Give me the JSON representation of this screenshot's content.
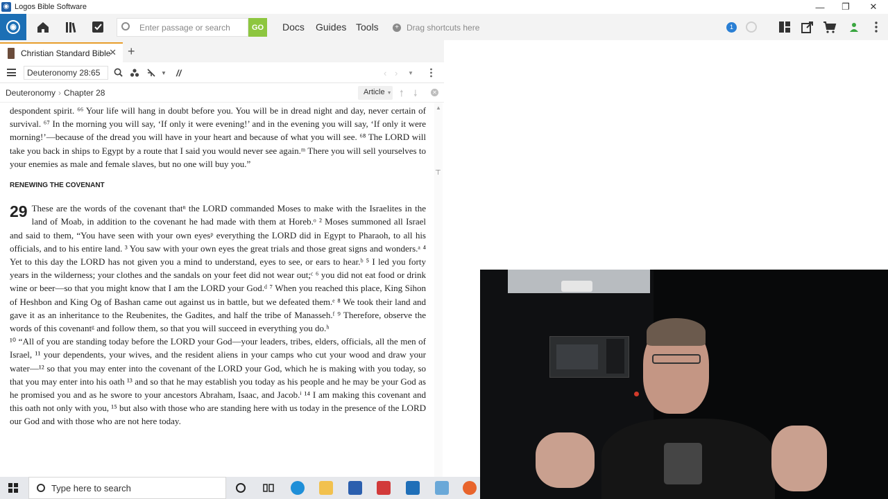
{
  "window": {
    "title": "Logos Bible Software",
    "minimize": "—",
    "restore": "❐",
    "close": "✕"
  },
  "toolbar": {
    "search_placeholder": "Enter passage or search",
    "go_label": "GO",
    "links": [
      "Docs",
      "Guides",
      "Tools"
    ],
    "shortcut_hint": "Drag shortcuts here",
    "notification_count": "1"
  },
  "tabs": [
    {
      "label": "Christian Standard Bible",
      "close": "✕"
    }
  ],
  "add_tab": "+",
  "panel": {
    "reference": "Deuteronomy 28:65",
    "parallel_icon": "//",
    "breadcrumb": [
      "Deuteronomy",
      "Chapter 28"
    ],
    "article_label": "Article"
  },
  "reader": {
    "p1": "despondent spirit. ⁶⁶ Your life will hang in doubt before you. You will be in dread night and day, never certain of survival. ⁶⁷ In the morning you will say, ‘If only it were evening!’ and in the evening you will say, ‘If only it were morning!’—because of the dread you will have in your heart and because of what you will see. ⁶⁸ The LORD will take you back in ships to Egypt by a route that I said you would never see again.ᵐ There you will sell yourselves to your enemies as male and female slaves, but no one will buy you.”",
    "heading": "RENEWING THE COVENANT",
    "chapter": "29",
    "p2": "These are the words of the covenant thatⁿ the LORD commanded Moses to make with the Israelites in the land of Moab, in addition to the covenant he had made with them at Horeb.ᵒ ² Moses summoned all Israel and said to them, “You have seen with your own eyesᵖ everything the LORD did in Egypt to Pharaoh, to all his officials, and to his entire land. ³ You saw with your own eyes the great trials and those great signs and wonders.ᵃ ⁴ Yet to this day the LORD has not given you a mind to understand, eyes to see, or ears to hear.ᵇ ⁵ I led you forty years in the wilderness; your clothes and the sandals on your feet did not wear out;ᶜ ⁶ you did not eat food or drink wine or beer—so that you might know that I am the LORD your God.ᵈ ⁷ When you reached this place, King Sihon of Heshbon and King Og of Bashan came out against us in battle, but we defeated them.ᵉ ⁸ We took their land and gave it as an inheritance to the Reubenites, the Gadites, and half the tribe of Manasseh.ᶠ ⁹ Therefore, observe the words of this covenantᵍ and follow them, so that you will succeed in everything you do.ʰ",
    "p3": "¹⁰ “All of you are standing today before the LORD your God—your leaders, tribes, elders, officials, all the men of Israel, ¹¹ your dependents, your wives, and the resident aliens in your camps who cut your wood and draw your water—¹² so that you may enter into the covenant of the LORD your God, which he is making with you today, so that you may enter into his oath ¹³ and so that he may establish you today as his people and he may be your God as he promised you and as he swore to your ancestors Abraham, Isaac, and Jacob.ⁱ ¹⁴ I am making this covenant and this oath not only with you, ¹⁵ but also with those who are standing here with us today in the presence of the LORD our God and with those who are not here today."
  },
  "taskbar": {
    "search_text": "Type here to search"
  },
  "colors": {
    "logos_blue": "#1c6fb5",
    "go_green": "#8dc63f",
    "tab_accent": "#e79d2a"
  }
}
